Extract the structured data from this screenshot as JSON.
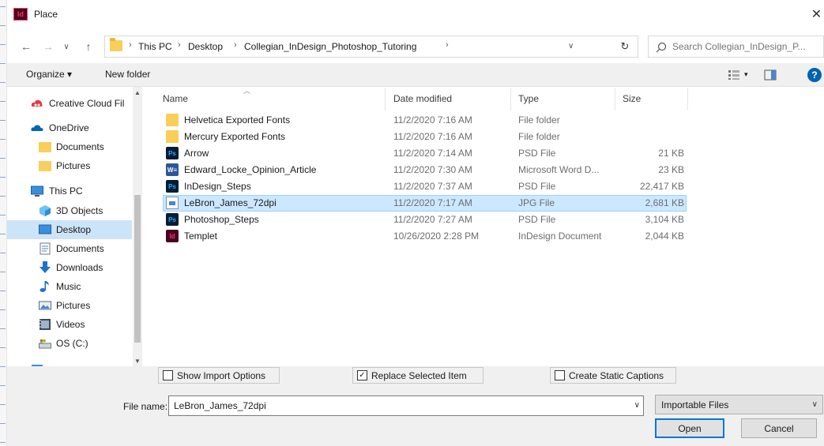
{
  "window": {
    "title": "Place",
    "app_icon": "Id",
    "close_glyph": "✕"
  },
  "nav_buttons": {
    "back": "←",
    "forward": "→",
    "recent": "∨",
    "up": "↑"
  },
  "address": {
    "crumbs": [
      "This PC",
      "Desktop",
      "Collegian_InDesign_Photoshop_Tutoring"
    ],
    "separator": "›",
    "dropdown_glyph": "∨",
    "refresh_glyph": "↻"
  },
  "search": {
    "placeholder": "Search Collegian_InDesign_P..."
  },
  "toolbar": {
    "organize": "Organize ▾",
    "new_folder": "New folder",
    "view_glyph": "▾",
    "help_glyph": "?"
  },
  "nav_pane": {
    "items": [
      {
        "label": "Creative Cloud Fil",
        "icon": "creative-cloud-icon"
      },
      {
        "label": "OneDrive",
        "icon": "onedrive-icon"
      },
      {
        "label": "Documents",
        "icon": "folder-icon"
      },
      {
        "label": "Pictures",
        "icon": "folder-icon"
      },
      {
        "label": "This PC",
        "icon": "pc-icon"
      },
      {
        "label": "3D Objects",
        "icon": "3d-objects-icon"
      },
      {
        "label": "Desktop",
        "icon": "desktop-icon",
        "selected": true
      },
      {
        "label": "Documents",
        "icon": "documents-icon"
      },
      {
        "label": "Downloads",
        "icon": "downloads-icon"
      },
      {
        "label": "Music",
        "icon": "music-icon"
      },
      {
        "label": "Pictures",
        "icon": "pictures-icon"
      },
      {
        "label": "Videos",
        "icon": "videos-icon"
      },
      {
        "label": "OS (C:)",
        "icon": "drive-icon"
      }
    ]
  },
  "file_list": {
    "columns": {
      "name": "Name",
      "date": "Date modified",
      "type": "Type",
      "size": "Size"
    },
    "rows": [
      {
        "name": "Helvetica Exported Fonts",
        "date": "11/2/2020 7:16 AM",
        "type": "File folder",
        "size": "",
        "icon": "folder"
      },
      {
        "name": "Mercury Exported Fonts",
        "date": "11/2/2020 7:16 AM",
        "type": "File folder",
        "size": "",
        "icon": "folder"
      },
      {
        "name": "Arrow",
        "date": "11/2/2020 7:14 AM",
        "type": "PSD File",
        "size": "21 KB",
        "icon": "ps"
      },
      {
        "name": "Edward_Locke_Opinion_Article",
        "date": "11/2/2020 7:30 AM",
        "type": "Microsoft Word D...",
        "size": "23 KB",
        "icon": "word"
      },
      {
        "name": "InDesign_Steps",
        "date": "11/2/2020 7:37 AM",
        "type": "PSD File",
        "size": "22,417 KB",
        "icon": "ps"
      },
      {
        "name": "LeBron_James_72dpi",
        "date": "11/2/2020 7:17 AM",
        "type": "JPG File",
        "size": "2,681 KB",
        "icon": "jpg",
        "selected": true
      },
      {
        "name": "Photoshop_Steps",
        "date": "11/2/2020 7:27 AM",
        "type": "PSD File",
        "size": "3,104 KB",
        "icon": "ps"
      },
      {
        "name": "Templet",
        "date": "10/26/2020 2:28 PM",
        "type": "InDesign Document",
        "size": "2,044 KB",
        "icon": "id"
      }
    ],
    "icon_text": {
      "ps": "Ps",
      "word": "W≡",
      "id": "Id"
    }
  },
  "options": {
    "show_import": {
      "label": "Show Import Options",
      "checked": false
    },
    "replace_selected": {
      "label": "Replace Selected Item",
      "checked": true,
      "check_glyph": "✓"
    },
    "static_captions": {
      "label": "Create Static Captions",
      "checked": false
    }
  },
  "file_name": {
    "label": "File name:",
    "value": "LeBron_James_72dpi",
    "dropdown_glyph": "∨"
  },
  "file_filter": {
    "label": "Importable Files",
    "dropdown_glyph": "∨"
  },
  "buttons": {
    "open": "Open",
    "cancel": "Cancel"
  },
  "colors": {
    "selection": "#cce8ff",
    "nav_selection": "#cce4f7",
    "accent": "#0078d7"
  }
}
